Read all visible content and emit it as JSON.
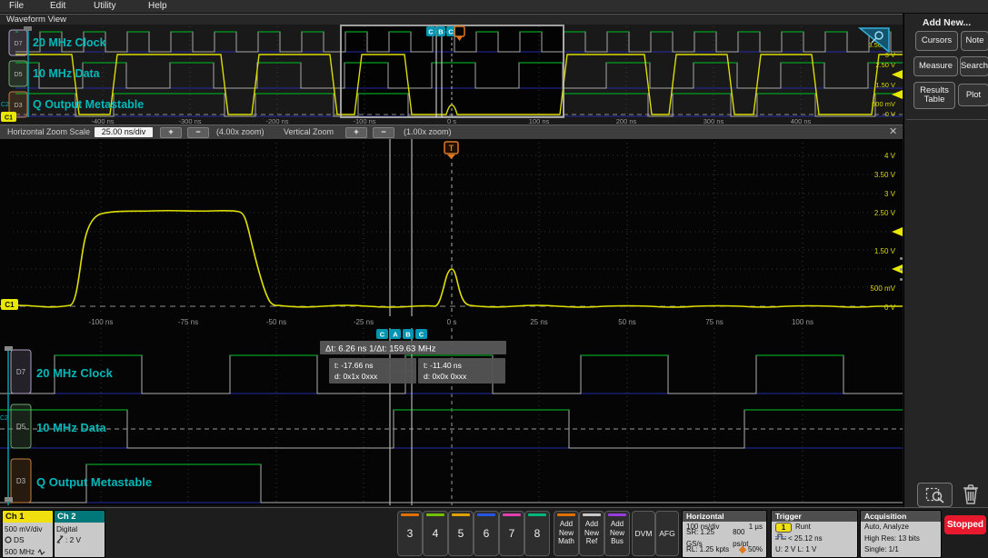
{
  "menu": {
    "items": [
      "File",
      "Edit",
      "Utility",
      "Help"
    ]
  },
  "titlebar": {
    "title": "Waveform View"
  },
  "overview": {
    "channels": [
      {
        "badge": "D7",
        "label": "20 MHz Clock"
      },
      {
        "badge": "D5",
        "label": "10 MHz Data"
      },
      {
        "badge": "D3",
        "label": "Q Output Metastable"
      }
    ],
    "scale": [
      "3.50",
      "3 V",
      "2.50 V",
      "1.50 V",
      "500 mV",
      "0 V"
    ],
    "time": [
      "-400 ns",
      "-300 ns",
      "-200 ns",
      "-100 ns",
      "0 s",
      "100 ns",
      "200 ns",
      "300 ns",
      "400 ns"
    ],
    "cursor_badges": [
      "C",
      "B",
      "C"
    ],
    "trigger": "T",
    "markers": {
      "c1": "C1",
      "c2": "C2"
    }
  },
  "zoombar": {
    "h_label": "Horizontal Zoom Scale",
    "h_value": "25.00 ns/div",
    "plus": "+",
    "minus": "−",
    "h_zoom": "(4.00x zoom)",
    "v_label": "Vertical Zoom",
    "v_zoom": "(1.00x zoom)",
    "close": "✕"
  },
  "zoomview": {
    "scale": [
      "4 V",
      "3.50 V",
      "3 V",
      "2.50 V",
      "1.50 V",
      "500 mV",
      "0 V"
    ],
    "time": [
      "-100 ns",
      "-75 ns",
      "-50 ns",
      "-25 ns",
      "0 s",
      "25 ns",
      "50 ns",
      "75 ns",
      "100 ns"
    ],
    "trigger": "T",
    "c1": "C1"
  },
  "digitalview": {
    "channels": [
      {
        "badge": "D7",
        "label": "20 MHz Clock"
      },
      {
        "badge": "D5",
        "label": "10 MHz Data"
      },
      {
        "badge": "D3",
        "label": "Q Output Metastable"
      }
    ],
    "cursor_badges": [
      "C",
      "A",
      "B",
      "C"
    ],
    "readout": {
      "delta": "Δt:  6.26 ns 1/Δt:  159.63 MHz",
      "a_t": "t: -17.66 ns",
      "a_d": "d: 0x1x 0xxx",
      "b_t": "t: -11.40 ns",
      "b_d": "d: 0x0x 0xxx"
    },
    "c2": "C2"
  },
  "rightpanel": {
    "title": "Add New...",
    "buttons": [
      "Cursors",
      "Note",
      "Measure",
      "Search",
      "Results Table",
      "Plot"
    ]
  },
  "bottombar": {
    "ch1": {
      "name": "Ch 1",
      "line1": "500 mV/div",
      "line2": "DS",
      "line3": "500 MHz"
    },
    "ch2": {
      "name": "Ch 2",
      "line1": "Digital",
      "line2": ": 2 V"
    },
    "channels": [
      {
        "label": "3",
        "color": "#e07000"
      },
      {
        "label": "4",
        "color": "#74c000"
      },
      {
        "label": "5",
        "color": "#e0a000"
      },
      {
        "label": "6",
        "color": "#2458e0"
      },
      {
        "label": "7",
        "color": "#e040b0"
      },
      {
        "label": "8",
        "color": "#00b87a"
      }
    ],
    "adds": [
      {
        "label": "Add New Math",
        "color": "#e07000"
      },
      {
        "label": "Add New Ref",
        "color": "#c8c8c8"
      },
      {
        "label": "Add New Bus",
        "color": "#9a3ae0"
      }
    ],
    "dvm": "DVM",
    "afg": "AFG",
    "horizontal": {
      "title": "Horizontal",
      "r1c1": "100 ns/div",
      "r1c2": "1 µs",
      "r2c1": "SR: 1.25 GS/s",
      "r2c2": "800 ps/pt",
      "r3c1": "RL: 1.25 kpts",
      "r3c2": "50%"
    },
    "trigger": {
      "title": "Trigger",
      "source": "1",
      "type": "Runt",
      "condition": "< 25.12 ns",
      "levels": "U: 2 V  L: 1 V"
    },
    "acquisition": {
      "title": "Acquisition",
      "r1": "Auto,  Analyze",
      "r2": "High Res: 13 bits",
      "r3": "Single: 1/1"
    },
    "stopped": "Stopped"
  }
}
